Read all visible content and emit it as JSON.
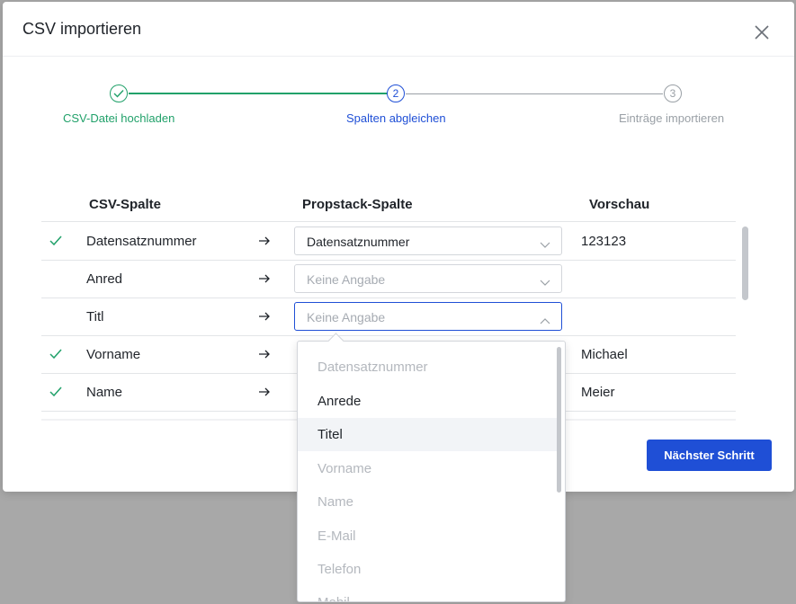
{
  "modal": {
    "title": "CSV importieren"
  },
  "steps": [
    {
      "number": "1",
      "label": "CSV-Datei hochladen",
      "state": "done"
    },
    {
      "number": "2",
      "label": "Spalten abgleichen",
      "state": "active"
    },
    {
      "number": "3",
      "label": "Einträge importieren",
      "state": "todo"
    }
  ],
  "table": {
    "headers": {
      "csv": "CSV-Spalte",
      "propstack": "Propstack-Spalte",
      "preview": "Vorschau"
    },
    "rows": [
      {
        "csv": "Datensatznummer",
        "mapped": "Datensatznummer",
        "preview": "123123",
        "matched": true
      },
      {
        "csv": "Anred",
        "mapped": "Keine Angabe",
        "preview": "",
        "matched": false
      },
      {
        "csv": "Titl",
        "mapped": "Keine Angabe",
        "preview": "",
        "matched": false
      },
      {
        "csv": "Vorname",
        "mapped": "",
        "preview": "Michael",
        "matched": true
      },
      {
        "csv": "Name",
        "mapped": "",
        "preview": "Meier",
        "matched": true
      }
    ]
  },
  "dropdown": {
    "options": [
      {
        "label": "Datensatznummer",
        "state": "disabled"
      },
      {
        "label": "Anrede",
        "state": "normal"
      },
      {
        "label": "Titel",
        "state": "hover"
      },
      {
        "label": "Vorname",
        "state": "disabled"
      },
      {
        "label": "Name",
        "state": "disabled"
      },
      {
        "label": "E-Mail",
        "state": "disabled"
      },
      {
        "label": "Telefon",
        "state": "disabled"
      },
      {
        "label": "Mobil",
        "state": "disabled"
      }
    ]
  },
  "footer": {
    "next_label": "Nächster Schritt"
  },
  "colors": {
    "primary": "#1f4fd6",
    "success": "#21a16a",
    "muted": "#9aa0a6",
    "overlay": "#a8a8a8"
  }
}
